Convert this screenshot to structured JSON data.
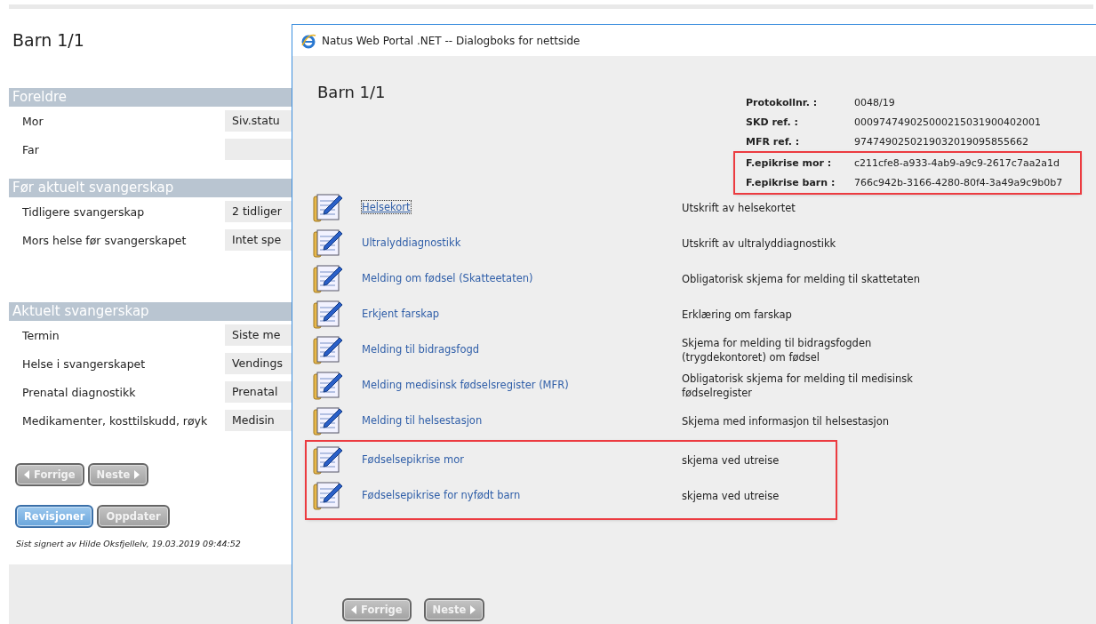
{
  "main": {
    "title": "Barn 1/1",
    "sections": [
      {
        "heading": "Foreldre",
        "rows": [
          {
            "label": "Mor",
            "value": "Siv.statu"
          },
          {
            "label": "Far",
            "value": ""
          }
        ]
      },
      {
        "heading": "Før aktuelt svangerskap",
        "rows": [
          {
            "label": "Tidligere svangerskap",
            "value": "2 tidliger"
          },
          {
            "label": "Mors helse før svangerskapet",
            "value": "Intet spe"
          }
        ]
      },
      {
        "heading": "Aktuelt svangerskap",
        "rows": [
          {
            "label": "Termin",
            "value": "Siste me"
          },
          {
            "label": "Helse i svangerskapet",
            "value": "Vendings"
          },
          {
            "label": "Prenatal diagnostikk",
            "value": "Prenatal"
          },
          {
            "label": "Medikamenter, kosttilskudd, røyk",
            "value": "Medisin"
          }
        ]
      }
    ],
    "nav_buttons": [
      {
        "label": "Forrige",
        "kind": "prev",
        "disabled": true
      },
      {
        "label": "Neste",
        "kind": "next",
        "disabled": true
      }
    ],
    "action_buttons": [
      {
        "label": "Revisjoner",
        "kind": "plain",
        "disabled": false
      },
      {
        "label": "Oppdater",
        "kind": "plain",
        "disabled": true
      }
    ],
    "signed_note": "Sist signert av Hilde Oksfjellelv, 19.03.2019 09:44:52"
  },
  "dialog": {
    "window_title": "Natus Web Portal .NET -- Dialogboks for nettside",
    "title": "Barn 1/1",
    "info_groups": [
      {
        "highlighted": false,
        "rows": [
          {
            "label": "Protokollnr. :",
            "value": "0048/19"
          },
          {
            "label": "SKD ref. :",
            "value": "000974749025000215031900402001"
          },
          {
            "label": "MFR ref. :",
            "value": "9747490250219032019095855662"
          }
        ]
      },
      {
        "highlighted": true,
        "rows": [
          {
            "label": "F.epikrise mor :",
            "value": "c211cfe8-a933-4ab9-a9c9-2617c7aa2a1d"
          },
          {
            "label": "F.epikrise barn :",
            "value": "766c942b-3166-4280-80f4-3a49a9c9b0b7"
          }
        ]
      }
    ],
    "document_groups": [
      {
        "highlighted": false,
        "items": [
          {
            "link": "Helsekort",
            "description": "Utskrift av helsekortet",
            "focused": true
          },
          {
            "link": "Ultralyddiagnostikk",
            "description": "Utskrift av ultralyddiagnostikk",
            "focused": false
          },
          {
            "link": "Melding om fødsel (Skatteetaten)",
            "description": "Obligatorisk skjema for melding til skattetaten",
            "focused": false
          },
          {
            "link": "Erkjent farskap",
            "description": "Erklæring om farskap",
            "focused": false
          },
          {
            "link": "Melding til bidragsfogd",
            "description": "Skjema for melding til bidragsfogden (trygdekontoret) om fødsel",
            "focused": false
          },
          {
            "link": "Melding medisinsk fødselsregister (MFR)",
            "description": "Obligatorisk skjema for melding til medisinsk fødselregister",
            "focused": false
          },
          {
            "link": "Melding til helsestasjon",
            "description": "Skjema med informasjon til helsestasjon",
            "focused": false
          }
        ]
      },
      {
        "highlighted": true,
        "items": [
          {
            "link": "Fødselsepikrise mor",
            "description": "skjema ved utreise",
            "focused": false
          },
          {
            "link": "Fødselsepikrise for nyfødt barn",
            "description": "skjema ved utreise",
            "focused": false
          }
        ]
      }
    ],
    "nav_buttons": [
      {
        "label": "Forrige",
        "kind": "prev",
        "disabled": true
      },
      {
        "label": "Neste",
        "kind": "next",
        "disabled": true
      }
    ]
  }
}
